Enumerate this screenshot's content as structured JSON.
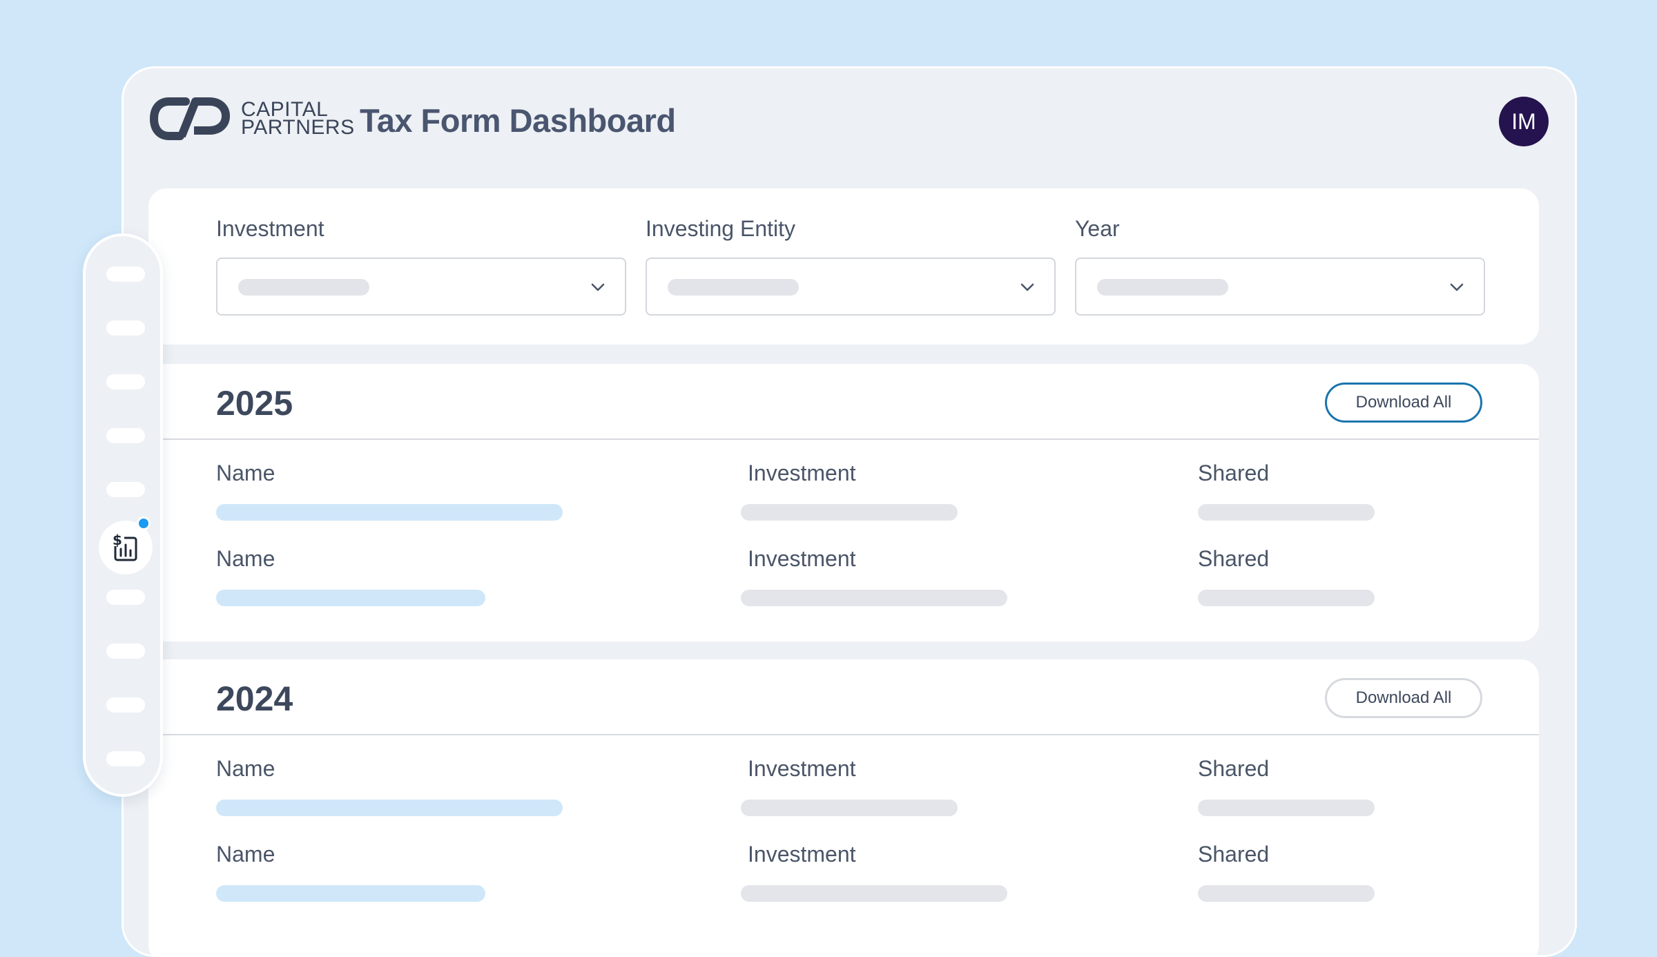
{
  "brand": {
    "line1": "CAPITAL",
    "line2": "PARTNERS"
  },
  "header": {
    "title": "Tax Form Dashboard",
    "avatar_initials": "IM"
  },
  "filters": [
    {
      "label": "Investment"
    },
    {
      "label": "Investing Entity"
    },
    {
      "label": "Year"
    }
  ],
  "sections": [
    {
      "year": "2025",
      "download_label": "Download All",
      "rows": [
        {
          "name": "Name",
          "investment": "Investment",
          "shared": "Shared"
        },
        {
          "name": "Name",
          "investment": "Investment",
          "shared": "Shared"
        }
      ]
    },
    {
      "year": "2024",
      "download_label": "Download All",
      "rows": [
        {
          "name": "Name",
          "investment": "Investment",
          "shared": "Shared"
        },
        {
          "name": "Name",
          "investment": "Investment",
          "shared": "Shared"
        }
      ]
    }
  ],
  "icons": {
    "logo": "capital-partners-logo",
    "chevron": "chevron-down-icon",
    "active_nav": "tax-report-icon"
  },
  "colors": {
    "background": "#cfe7f9",
    "avatar": "#24134e",
    "accent": "#1a74ad",
    "notification": "#1a9af0"
  }
}
